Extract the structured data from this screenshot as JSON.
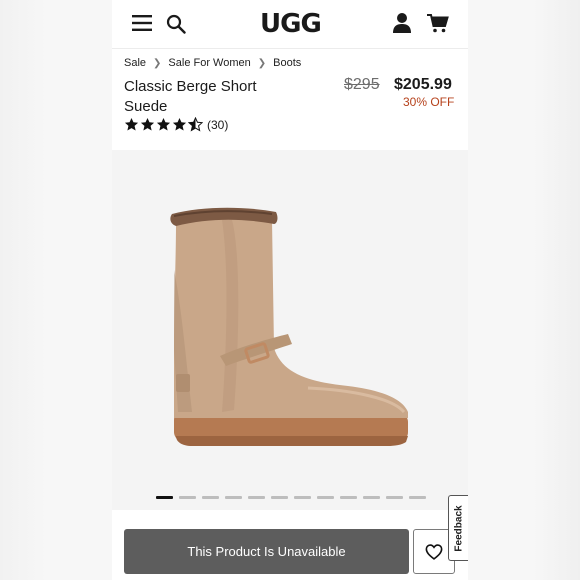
{
  "header": {
    "logo": "UGG",
    "icons": [
      "menu-icon",
      "search-icon",
      "account-icon",
      "cart-icon"
    ]
  },
  "breadcrumb": [
    "Sale",
    "Sale For Women",
    "Boots"
  ],
  "product": {
    "title": "Classic Berge Short Suede",
    "price_original": "$295",
    "price_sale": "$205.99",
    "discount": "30% OFF",
    "rating_value": 4.5,
    "rating_count": "(30)"
  },
  "carousel": {
    "total_images": 12,
    "active_index": 0
  },
  "actions": {
    "unavailable_label": "This Product Is Unavailable",
    "feedback_label": "Feedback"
  },
  "colors": {
    "discount": "#b6421c",
    "button_bg": "#5d5d5d",
    "boot": "#c9a789"
  }
}
